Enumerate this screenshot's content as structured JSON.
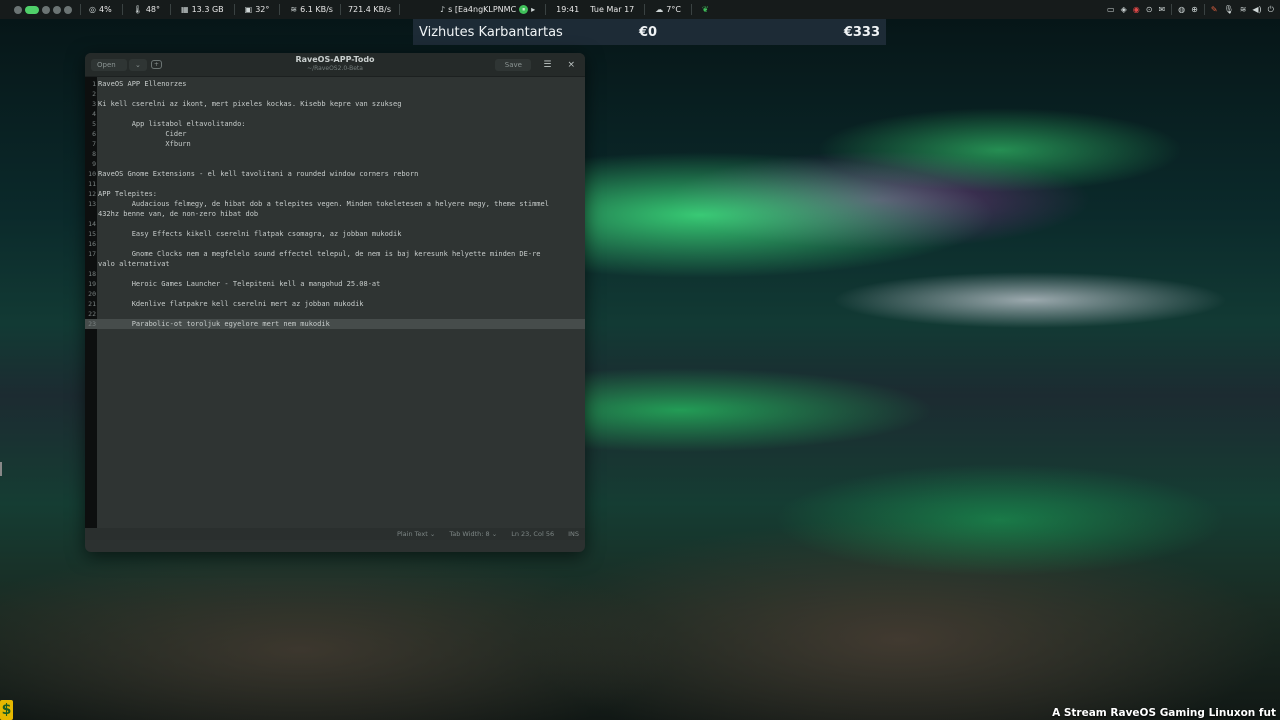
{
  "topbar": {
    "cpu": "4%",
    "cpu_temp": "48°",
    "memory": "13.3 GB",
    "gpu_temp": "32°",
    "net_down": "6.1 KB/s",
    "net_up": "721.4 KB/s",
    "media": "s [Ea4ngKLPNMC",
    "time": "19:41",
    "date": "Tue Mar 17",
    "weather": "7°C"
  },
  "banner": {
    "title": "Vizhutes Karbantartas",
    "value1": "€0",
    "value2": "€333"
  },
  "window": {
    "title": "RaveOS-APP-Todo",
    "subtitle": "~/RaveOS2.0-Beta",
    "open_label": "Open",
    "save_label": "Save"
  },
  "editor": {
    "lines": [
      {
        "n": "1",
        "t": "RaveOS APP Ellenorzes"
      },
      {
        "n": "2",
        "t": ""
      },
      {
        "n": "3",
        "t": "Ki kell cserelni az ikont, mert pixeles kockas. Kisebb kepre van szukseg"
      },
      {
        "n": "4",
        "t": ""
      },
      {
        "n": "5",
        "t": "        App listabol eltavolitando:"
      },
      {
        "n": "6",
        "t": "                Cider"
      },
      {
        "n": "7",
        "t": "                Xfburn"
      },
      {
        "n": "8",
        "t": ""
      },
      {
        "n": "9",
        "t": ""
      },
      {
        "n": "10",
        "t": "RaveOS Gnome Extensions - el kell tavolitani a rounded window corners reborn"
      },
      {
        "n": "11",
        "t": ""
      },
      {
        "n": "12",
        "t": "APP Telepites:"
      },
      {
        "n": "13",
        "t": "        Audacious felmegy, de hibat dob a telepites vegen. Minden tokeletesen a helyere megy, theme stimmel"
      },
      {
        "n": "",
        "t": "432hz benne van, de non-zero hibat dob"
      },
      {
        "n": "14",
        "t": ""
      },
      {
        "n": "15",
        "t": "        Easy Effects kikell cserelni flatpak csomagra, az jobban mukodik"
      },
      {
        "n": "16",
        "t": ""
      },
      {
        "n": "17",
        "t": "        Gnome Clocks nem a megfelelo sound effectel telepul, de nem is baj keresunk helyette minden DE-re"
      },
      {
        "n": "",
        "t": "valo alternativat"
      },
      {
        "n": "18",
        "t": ""
      },
      {
        "n": "19",
        "t": "        Heroic Games Launcher - Telepiteni kell a mangohud 25.08-at"
      },
      {
        "n": "20",
        "t": ""
      },
      {
        "n": "21",
        "t": "        Kdenlive flatpakre kell cserelni mert az jobban mukodik"
      },
      {
        "n": "22",
        "t": ""
      },
      {
        "n": "23",
        "t": "        Parabolic-ot toroljuk egyelore mert nem mukodik"
      }
    ],
    "current_line_index": 24
  },
  "status": {
    "language": "Plain Text",
    "tab_width": "Tab Width: 8",
    "position": "Ln 23, Col 56",
    "mode": "INS"
  },
  "caption": "A Stream RaveOS Gaming Linuxon fut",
  "colors": {
    "accent_green": "#4fd06a",
    "banner_bg": "#1d2b36",
    "editor_bg": "#2f3433"
  }
}
